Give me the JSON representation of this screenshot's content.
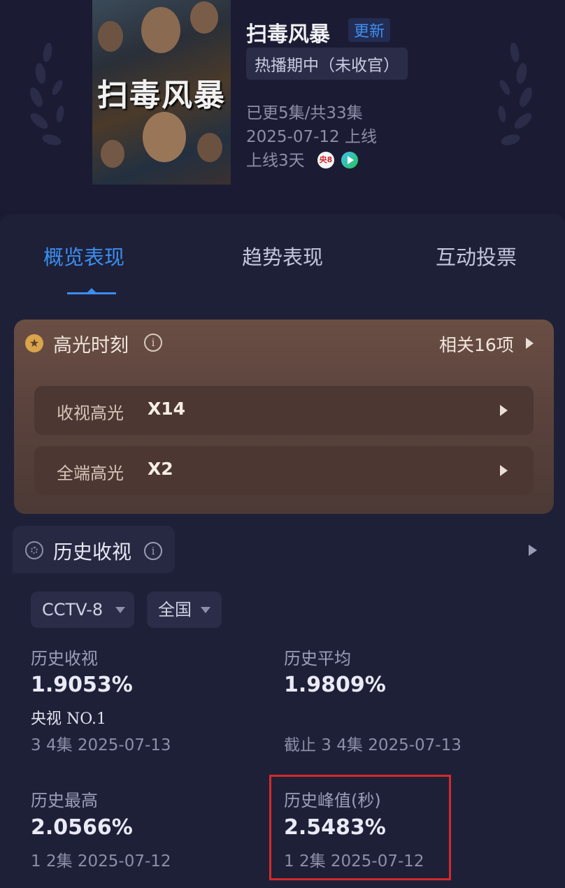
{
  "show": {
    "title": "扫毒风暴",
    "update_badge": "更新",
    "status": "热播期中（未收官）",
    "episodes": "已更5集/共33集",
    "premiere": "2025-07-12 上线",
    "days_online": "上线3天",
    "poster_title": "扫毒风暴",
    "channels": [
      "cctv8-logo",
      "tencent-video-logo"
    ],
    "cctv8_logo_text": "央8"
  },
  "tabs": [
    {
      "label": "概览表现",
      "active": true
    },
    {
      "label": "趋势表现",
      "active": false
    },
    {
      "label": "互动投票",
      "active": false
    }
  ],
  "highlights": {
    "title": "高光时刻",
    "related": "相关16项",
    "icon": "star-badge-icon",
    "rows": [
      {
        "label": "收视高光",
        "count": "X14"
      },
      {
        "label": "全端高光",
        "count": "X2"
      }
    ]
  },
  "history": {
    "title": "历史收视",
    "icon": "reel-icon",
    "filters": {
      "channel": "CCTV-8",
      "region": "全国"
    },
    "stats": {
      "rating": {
        "label": "历史收视",
        "value": "1.9053%",
        "rank": "央视 NO.1",
        "sub": "3 4集 2025-07-13"
      },
      "average": {
        "label": "历史平均",
        "value": "1.9809%",
        "sub": "截止 3 4集 2025-07-13"
      },
      "highest": {
        "label": "历史最高",
        "value": "2.0566%",
        "sub": "1 2集 2025-07-12"
      },
      "peak": {
        "label": "历史峰值(秒)",
        "value": "2.5483%",
        "sub": "1 2集 2025-07-12"
      }
    }
  },
  "colors": {
    "background": "#1a1b33",
    "accent": "#3b8ef0",
    "highlight_card": "#5b433d",
    "annotation_box": "#d42a2a"
  }
}
